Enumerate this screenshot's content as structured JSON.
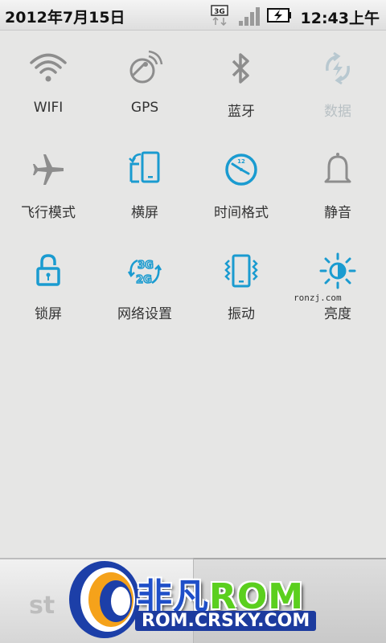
{
  "status_bar": {
    "date": "2012年7月15日",
    "network_type": "3G",
    "time": "12:43上午"
  },
  "toggles": [
    {
      "label": "WIFI",
      "icon": "wifi-icon",
      "state": "off"
    },
    {
      "label": "GPS",
      "icon": "gps-icon",
      "state": "off"
    },
    {
      "label": "蓝牙",
      "icon": "bluetooth-icon",
      "state": "off"
    },
    {
      "label": "数据",
      "icon": "data-sync-icon",
      "state": "disabled"
    },
    {
      "label": "飞行模式",
      "icon": "airplane-icon",
      "state": "off"
    },
    {
      "label": "横屏",
      "icon": "rotate-screen-icon",
      "state": "on"
    },
    {
      "label": "时间格式",
      "icon": "clock-icon",
      "state": "on"
    },
    {
      "label": "静音",
      "icon": "bell-icon",
      "state": "off"
    },
    {
      "label": "锁屏",
      "icon": "lock-icon",
      "state": "on"
    },
    {
      "label": "网络设置",
      "icon": "network-3g-2g-icon",
      "state": "on"
    },
    {
      "label": "振动",
      "icon": "vibrate-icon",
      "state": "on"
    },
    {
      "label": "亮度",
      "icon": "brightness-icon",
      "state": "on"
    }
  ],
  "watermark": "ronzj.com",
  "logo": {
    "name_cn": "非凡",
    "name_rom": "ROM",
    "url": "ROM.CRSKY.COM"
  },
  "bottom": {
    "left_text": "st"
  },
  "colors": {
    "active": "#1a9bd0",
    "inactive": "#8d8d8d",
    "disabled": "#b8c8d0",
    "background": "#e6e6e5"
  }
}
